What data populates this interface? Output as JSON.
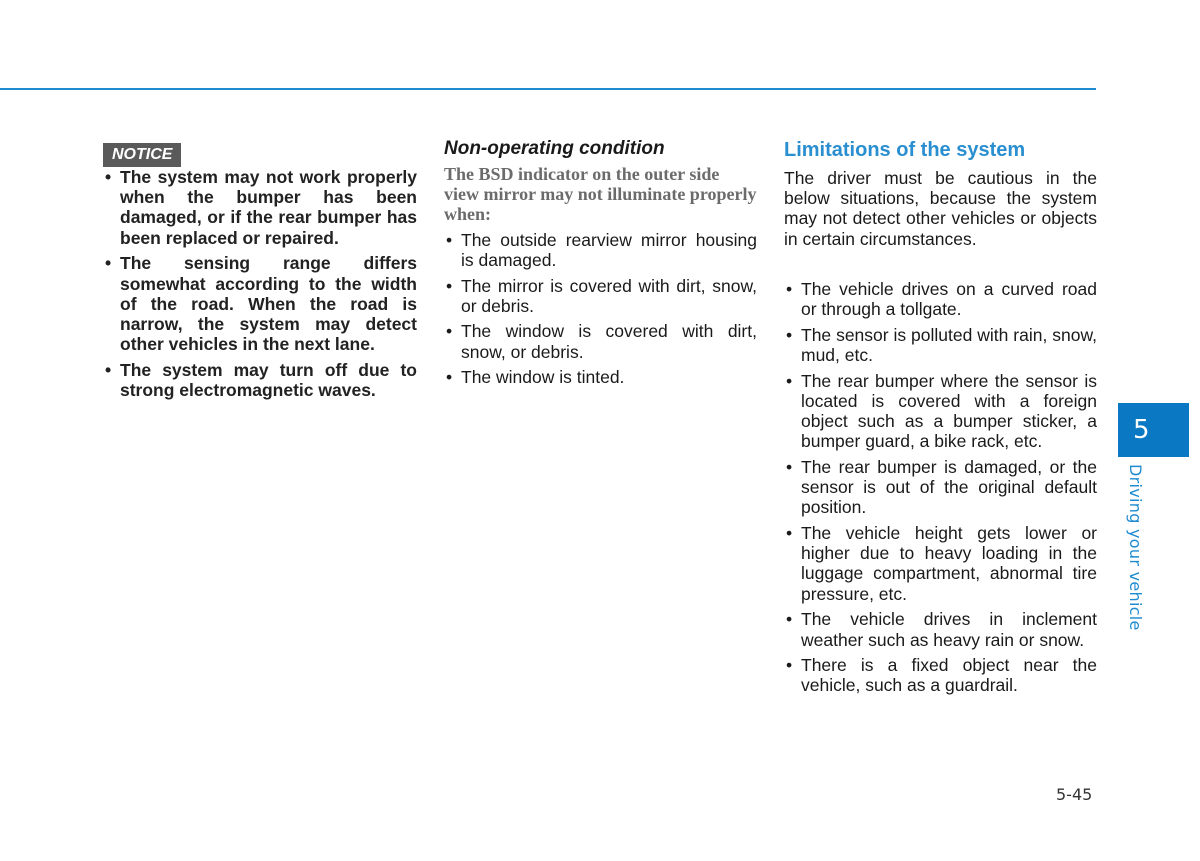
{
  "colors": {
    "accent": "#1e8bd0",
    "tab_background": "#0a78c2",
    "notice_badge": "#5a5a5a",
    "lead_gray": "#6b6b6b"
  },
  "notice": {
    "badge": "NOTICE",
    "items": [
      "The system may not work properly when the bumper has been damaged, or if the rear bumper has been replaced or repaired.",
      "The sensing range differs somewhat according to the width of the road. When the road is narrow, the system may detect other vehicles in the next lane.",
      "The system may turn off due to strong electromagnetic waves."
    ]
  },
  "non_operating": {
    "heading": "Non-operating condition",
    "lead": "The BSD indicator on the outer side view mirror may not illuminate properly when:",
    "items": [
      "The outside rearview mirror housing is damaged.",
      "The mirror is covered with dirt, snow, or debris.",
      "The window is covered with dirt, snow, or debris.",
      "The window is tinted."
    ]
  },
  "limitations": {
    "heading": "Limitations of the system",
    "intro": "The driver must be cautious in the below situations, because the system may not detect other vehicles or objects in certain circumstances.",
    "items": [
      "The vehicle drives on a curved road or through a tollgate.",
      "The sensor is polluted with rain, snow, mud, etc.",
      "The rear bumper where the sensor is located is covered with a foreign object such as a bumper sticker, a bumper guard, a bike rack, etc.",
      "The rear bumper is damaged, or the sensor is out of the original default position.",
      "The vehicle height gets lower or higher due to heavy loading in the luggage compartment, abnormal tire pressure, etc.",
      "The vehicle drives in inclement weather such as heavy rain or snow.",
      "There is a fixed object near the vehicle, such as a guardrail."
    ]
  },
  "chapter": {
    "number": "5",
    "label": "Driving your vehicle"
  },
  "page_number": "5-45"
}
